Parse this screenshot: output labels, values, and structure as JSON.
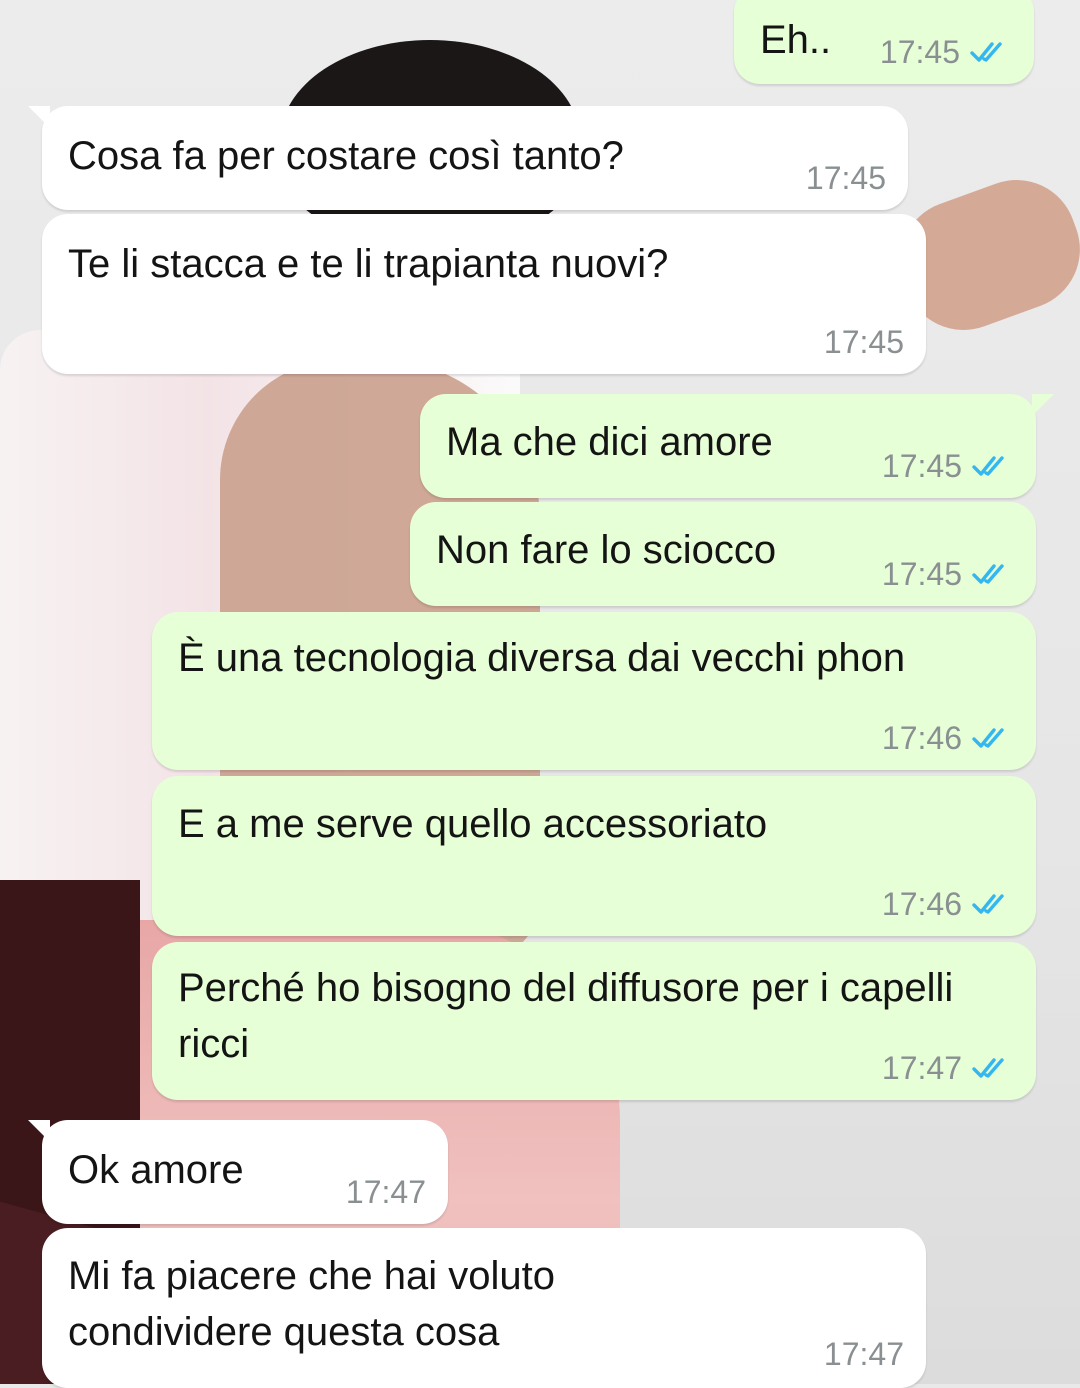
{
  "chat": {
    "messages": [
      {
        "dir": "out",
        "text": "Eh..",
        "time": "17:45",
        "status": "read"
      },
      {
        "dir": "in",
        "text": "Cosa fa per costare così tanto?",
        "time": "17:45"
      },
      {
        "dir": "in",
        "text": "Te li stacca e te li trapianta nuovi?",
        "time": "17:45"
      },
      {
        "dir": "out",
        "text": "Ma che dici amore",
        "time": "17:45",
        "status": "read"
      },
      {
        "dir": "out",
        "text": "Non fare lo sciocco",
        "time": "17:45",
        "status": "read"
      },
      {
        "dir": "out",
        "text": "È una tecnologia diversa dai vecchi phon",
        "time": "17:46",
        "status": "read"
      },
      {
        "dir": "out",
        "text": "E a me serve quello accessoriato",
        "time": "17:46",
        "status": "read"
      },
      {
        "dir": "out",
        "text": "Perché ho bisogno del diffusore per i capelli ricci",
        "time": "17:47",
        "status": "read"
      },
      {
        "dir": "in",
        "text": "Ok amore",
        "time": "17:47"
      },
      {
        "dir": "in",
        "text": "Mi fa piacere che hai voluto condividere questa cosa",
        "time": "17:47"
      }
    ]
  },
  "colors": {
    "incoming_bubble": "#ffffff",
    "outgoing_bubble": "#e6ffd6",
    "read_ticks": "#34b7f1",
    "timestamp": "#8a8f92"
  },
  "icons": {
    "read_receipt": "double-check-icon"
  }
}
